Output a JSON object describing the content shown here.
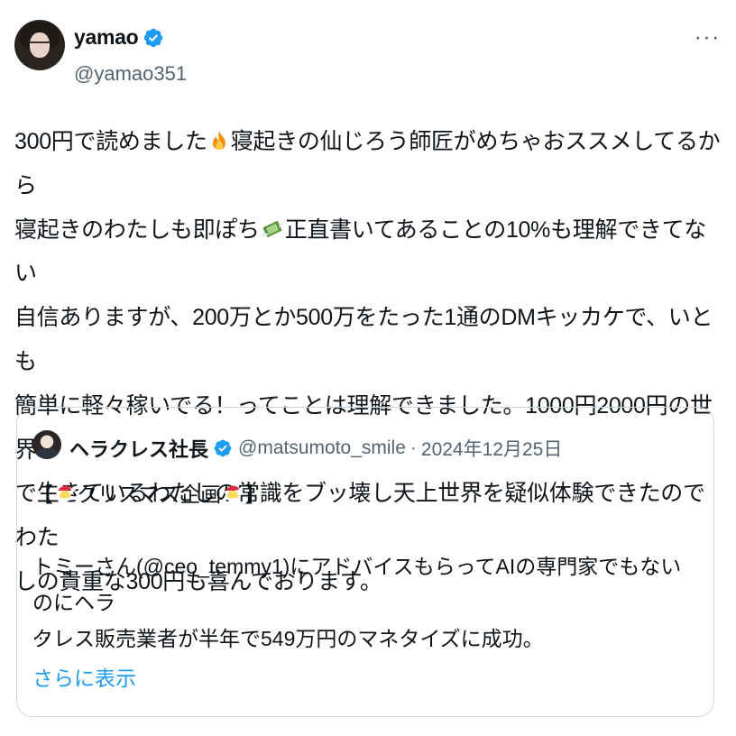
{
  "author": {
    "display_name": "yamao",
    "handle": "@yamao351",
    "verified": true
  },
  "more_menu": {
    "icon": "more-horizontal-icon",
    "label": "···"
  },
  "tweet": {
    "seg1": "300円で読めました",
    "seg2": "寝起きの仙じろう師匠がめちゃおススメしてるから\n寝起きのわたしも即ぽち",
    "seg3": "正直書いてあることの10%も理解できてない\n自信ありますが、200万とか500万をたった1通のDMキッカケで、いとも\n簡単に軽々稼いでる！ってことは理解できました。1000円2000円の世界\nで生きているわたしの常識をブッ壊し天上世界を疑似体験できたのでわた\nしの貴重な300円も喜んでおります。",
    "emoji_1": "fire-emoji",
    "emoji_2": "money-with-wings-emoji"
  },
  "quoted_tweet": {
    "display_name": "ヘラクレス社長",
    "verified": true,
    "handle": "@matsumoto_smile",
    "separator": "·",
    "date": "2024年12月25日",
    "line1_open": "【",
    "line1_text": "クリスマス企画",
    "line1_close": "】",
    "body": "トミーさん(@ceo_temmy1)にアドバイスもらってAIの専門家でもないのにヘラ\nクレス販売業者が半年で549万円のマネタイズに成功。",
    "ellipsis": "...",
    "show_more": "さらに表示",
    "emoji_santa": "santa-emoji"
  },
  "colors": {
    "text_primary": "#0f1419",
    "text_secondary": "#536471",
    "link": "#1d9bf0",
    "verified_badge": "#1d9bf0",
    "card_border": "#cfd9de"
  }
}
